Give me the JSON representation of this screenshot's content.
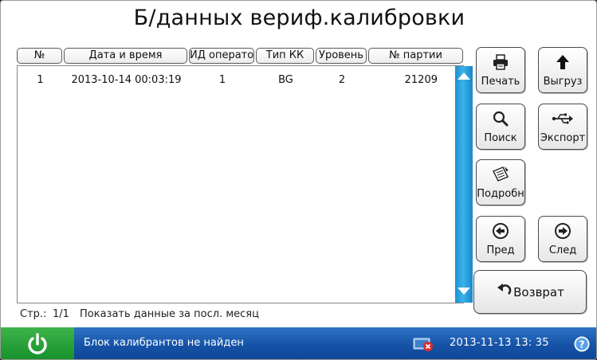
{
  "title": "Б/данных вериф.калибровки",
  "table": {
    "columns": [
      "№",
      "Дата и время",
      "ИД оператора",
      "Тип КК",
      "Уровень",
      "№ партии"
    ],
    "rows": [
      [
        "1",
        "2013-10-14 00:03:19",
        "1",
        "BG",
        "2",
        "21209"
      ]
    ]
  },
  "footer": {
    "page_label": "Стр.:",
    "page_value": "1/1",
    "period_text": "Показать данные за посл. месяц"
  },
  "buttons": {
    "print": "Печать",
    "upload": "Выгруз",
    "search": "Поиск",
    "export": "Экспорт",
    "details": "Подробн",
    "prev": "Пред",
    "next": "След",
    "back": "Возврат"
  },
  "status_bar": {
    "message": "Блок калибрантов не найден",
    "datetime": "2013-11-13  13: 35"
  },
  "colors": {
    "status_bar": "#1552a6",
    "power_button": "#1f9a32",
    "scrollbar": "#2ea6e0"
  },
  "icons": [
    "printer-icon",
    "arrow-up-icon",
    "magnifier-icon",
    "usb-icon",
    "note-icon",
    "arrow-left-circle-icon",
    "arrow-right-circle-icon",
    "undo-arrow-icon",
    "power-icon",
    "network-error-icon",
    "help-icon"
  ]
}
